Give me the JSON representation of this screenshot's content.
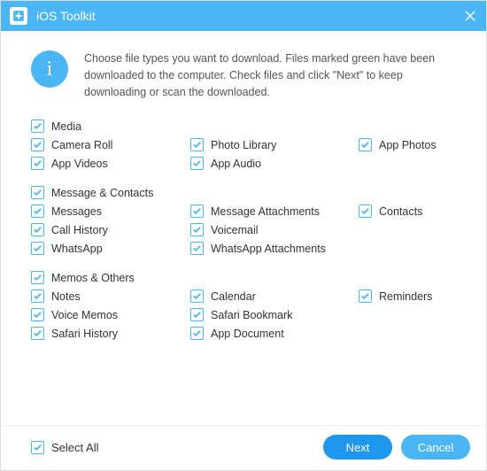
{
  "title": "iOS Toolkit",
  "info_text": "Choose file types you want to download. Files marked green have been downloaded to the computer. Check files and click \"Next\" to keep downloading or scan the downloaded.",
  "groups": [
    {
      "name": "Media",
      "checked": true,
      "items": [
        {
          "label": "Camera Roll",
          "checked": true
        },
        {
          "label": "Photo Library",
          "checked": true
        },
        {
          "label": "App Photos",
          "checked": true
        },
        {
          "label": "App Videos",
          "checked": true
        },
        {
          "label": "App Audio",
          "checked": true
        }
      ]
    },
    {
      "name": "Message & Contacts",
      "checked": true,
      "items": [
        {
          "label": "Messages",
          "checked": true
        },
        {
          "label": "Message Attachments",
          "checked": true
        },
        {
          "label": "Contacts",
          "checked": true
        },
        {
          "label": "Call History",
          "checked": true
        },
        {
          "label": "Voicemail",
          "checked": true
        },
        {
          "label": "",
          "checked": false
        },
        {
          "label": "WhatsApp",
          "checked": true
        },
        {
          "label": "WhatsApp Attachments",
          "checked": true
        }
      ]
    },
    {
      "name": "Memos & Others",
      "checked": true,
      "items": [
        {
          "label": "Notes",
          "checked": true
        },
        {
          "label": "Calendar",
          "checked": true
        },
        {
          "label": "Reminders",
          "checked": true
        },
        {
          "label": "Voice Memos",
          "checked": true
        },
        {
          "label": "Safari Bookmark",
          "checked": true
        },
        {
          "label": "",
          "checked": false
        },
        {
          "label": "Safari History",
          "checked": true
        },
        {
          "label": "App Document",
          "checked": true
        }
      ]
    }
  ],
  "select_all": {
    "label": "Select All",
    "checked": true
  },
  "buttons": {
    "next": "Next",
    "cancel": "Cancel"
  },
  "colors": {
    "accent": "#4ab6f5",
    "primary_btn": "#1f97ef"
  }
}
